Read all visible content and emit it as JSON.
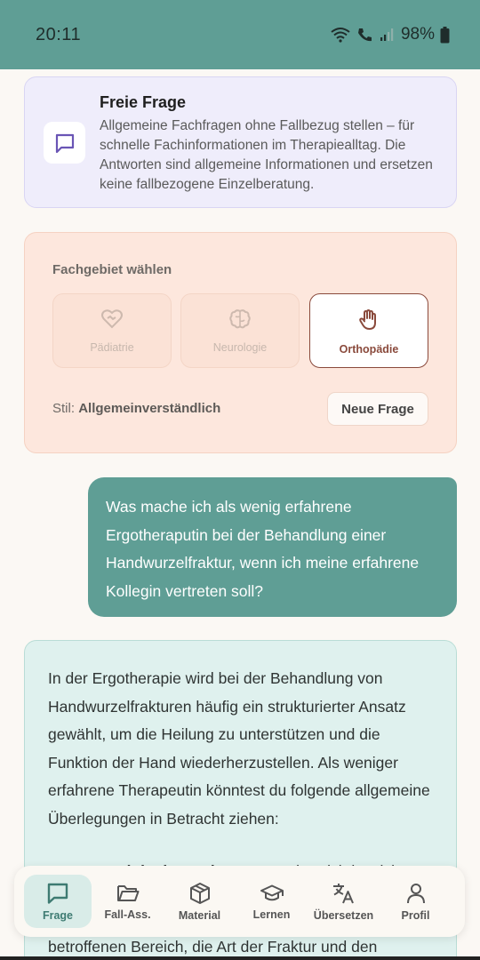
{
  "status": {
    "time": "20:11",
    "battery": "98%"
  },
  "info_card": {
    "icon": "chat-bubble-icon",
    "title": "Freie Frage",
    "text": "Allgemeine Fachfragen ohne Fallbezug stellen – für schnelle Fachinformationen im Therapiealltag. Die Antworten sind allgemeine Informationen und ersetzen keine fallbezogene Einzelberatung."
  },
  "specialty": {
    "heading": "Fachgebiet wählen",
    "options": [
      {
        "label": "Pädiatrie",
        "icon": "heart-hand-icon",
        "selected": false
      },
      {
        "label": "Neurologie",
        "icon": "brain-icon",
        "selected": false
      },
      {
        "label": "Orthopädie",
        "icon": "hand-icon",
        "selected": true
      }
    ],
    "style_prefix": "Stil:",
    "style_value": "Allgemeinverständlich",
    "new_question": "Neue Frage"
  },
  "conversation": {
    "user_message": "Was mache ich als wenig erfahrene Ergotheraputin bei der Behandlung einer Handwurzelfraktur, wenn ich meine erfahrene Kollegin vertreten soll?",
    "answer_intro": "In der Ergotherapie wird bei der Behandlung von Handwurzelfrakturen häufig ein strukturierter Ansatz gewählt, um die Heilung zu unterstützen und die Funktion der Hand wiederherzustellen. Als weniger erfahrene Therapeutin könntest du folgende allgemeine Überlegungen in Betracht ziehen:",
    "answer_item_number": "1.",
    "answer_item_title": "Verständnis der Verletzung",
    "answer_item_text": ": Es ist wichtig, sich",
    "answer_tail": "betroffenen Bereich, die Art der Fraktur und den"
  },
  "nav": [
    {
      "label": "Frage",
      "icon": "chat-bubble-icon",
      "active": true
    },
    {
      "label": "Fall-Ass.",
      "icon": "folder-icon",
      "active": false
    },
    {
      "label": "Material",
      "icon": "box-icon",
      "active": false
    },
    {
      "label": "Lernen",
      "icon": "graduation-cap-icon",
      "active": false
    },
    {
      "label": "Übersetzen",
      "icon": "translate-icon",
      "active": false
    },
    {
      "label": "Profil",
      "icon": "person-icon",
      "active": false
    }
  ],
  "colors": {
    "primary": "#5f9e95",
    "info_bg": "#efedfb",
    "specialty_bg": "#fde7dd",
    "answer_bg": "#dff1ee",
    "accent_selected": "#8a4a3c"
  }
}
